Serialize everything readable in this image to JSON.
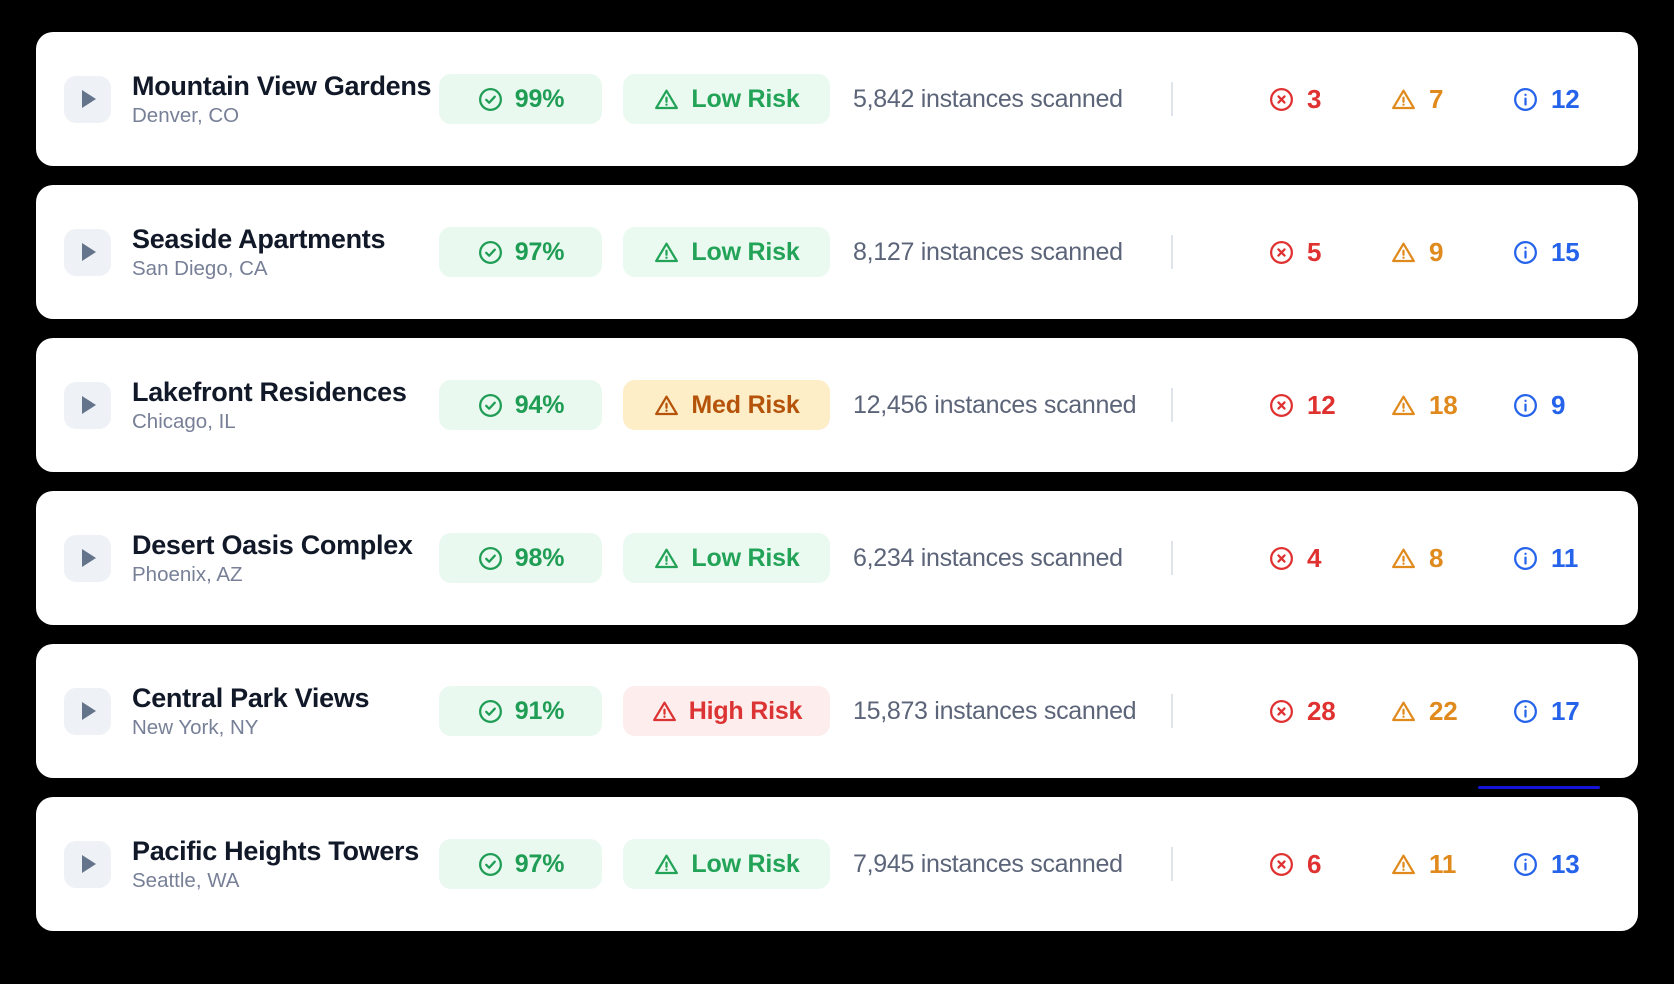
{
  "icons": {
    "expander": "play-triangle-icon",
    "score": "check-circle-icon",
    "risk": "warning-triangle-icon",
    "critical": "x-circle-icon",
    "warning": "warning-triangle-icon",
    "info": "info-circle-icon"
  },
  "colors": {
    "background": "#000000",
    "card": "#ffffff",
    "score_green": "#1f9d55",
    "low_risk": "#22a357",
    "med_risk": "#b45309",
    "high_risk": "#dc3434",
    "critical": "#e03131",
    "warning": "#e08a1e",
    "info": "#2563eb",
    "focus_bar": "#1414d8"
  },
  "properties": [
    {
      "name": "Mountain View Gardens",
      "location": "Denver, CO",
      "score": "99%",
      "risk": "Low Risk",
      "risk_level": "low",
      "instances": "5,842 instances scanned",
      "critical": "3",
      "warnings": "7",
      "info": "12"
    },
    {
      "name": "Seaside Apartments",
      "location": "San Diego, CA",
      "score": "97%",
      "risk": "Low Risk",
      "risk_level": "low",
      "instances": "8,127 instances scanned",
      "critical": "5",
      "warnings": "9",
      "info": "15"
    },
    {
      "name": "Lakefront Residences",
      "location": "Chicago, IL",
      "score": "94%",
      "risk": "Med Risk",
      "risk_level": "med",
      "instances": "12,456 instances scanned",
      "critical": "12",
      "warnings": "18",
      "info": "9"
    },
    {
      "name": "Desert Oasis Complex",
      "location": "Phoenix, AZ",
      "score": "98%",
      "risk": "Low Risk",
      "risk_level": "low",
      "instances": "6,234 instances scanned",
      "critical": "4",
      "warnings": "8",
      "info": "11"
    },
    {
      "name": "Central Park Views",
      "location": "New York, NY",
      "score": "91%",
      "risk": "High Risk",
      "risk_level": "high",
      "instances": "15,873 instances scanned",
      "critical": "28",
      "warnings": "22",
      "info": "17"
    },
    {
      "name": "Pacific Heights Towers",
      "location": "Seattle, WA",
      "score": "97%",
      "risk": "Low Risk",
      "risk_level": "low",
      "instances": "7,945 instances scanned",
      "critical": "6",
      "warnings": "11",
      "info": "13"
    }
  ]
}
